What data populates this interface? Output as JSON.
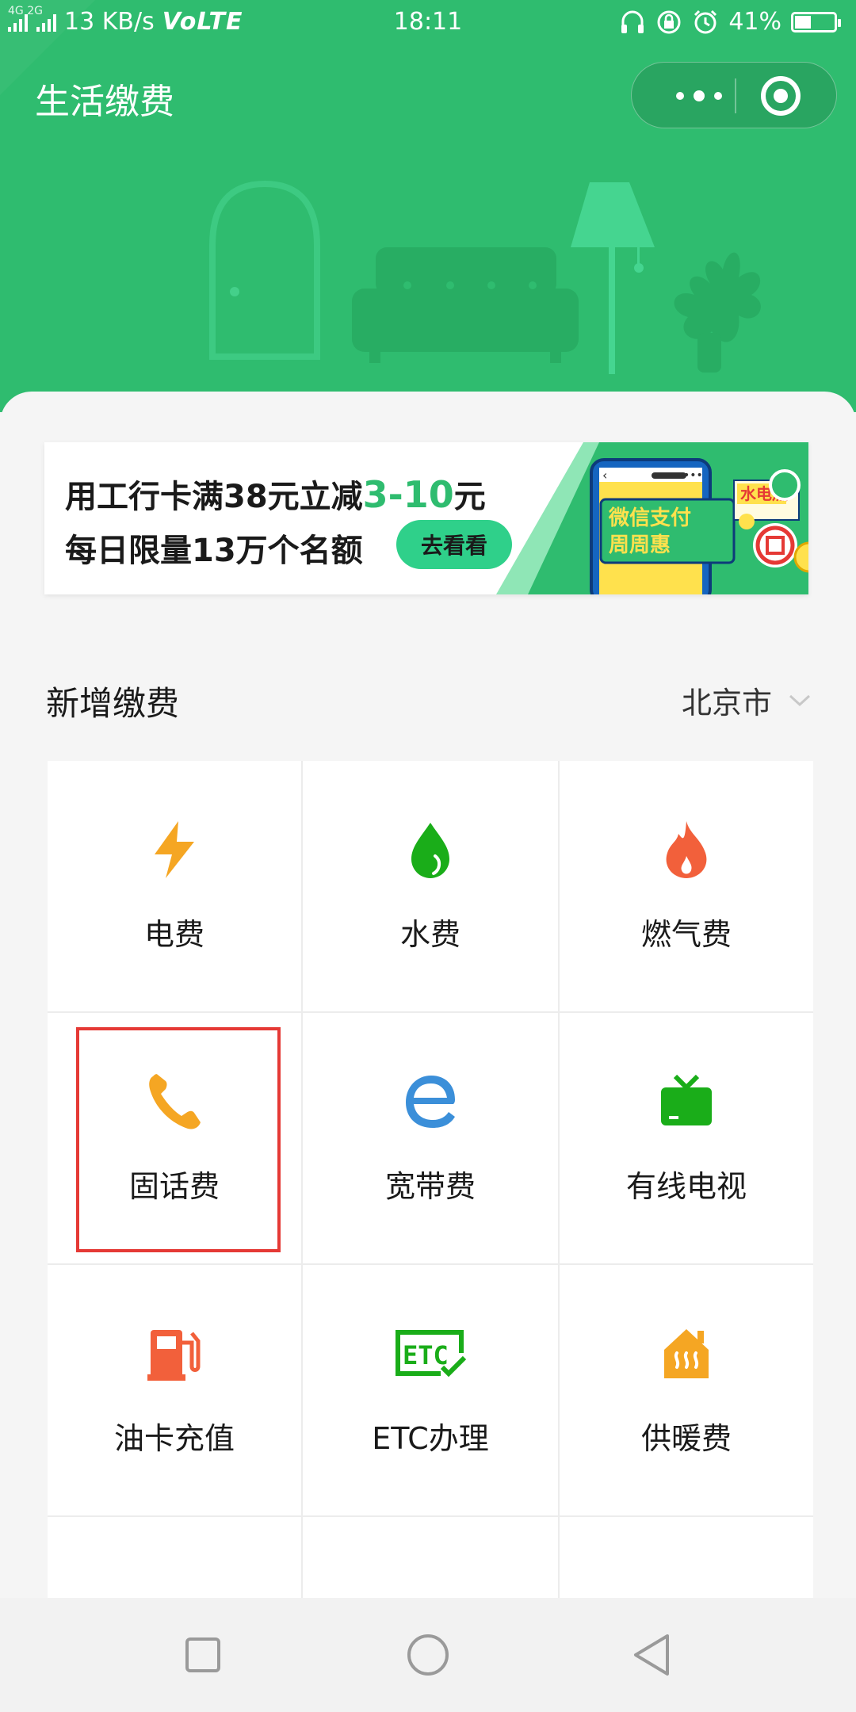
{
  "status_bar": {
    "network": "4G 2G",
    "speed": "13 KB/s",
    "volte": "VoLTE",
    "time": "18:11",
    "battery": "41%",
    "battery_level": 0.41
  },
  "nav": {
    "title": "生活缴费"
  },
  "banner": {
    "line1_prefix": "用工行卡满38元立减",
    "line1_accent": "3-10",
    "line1_suffix": "元",
    "line2": "每日限量13万个名额",
    "button": "去看看",
    "art_tag": "水电燃",
    "art_line1": "微信支付",
    "art_line2": "周周惠"
  },
  "section": {
    "title": "新增缴费",
    "city": "北京市"
  },
  "services": [
    {
      "label": "电费",
      "icon": "lightning-icon",
      "color": "#f5a623"
    },
    {
      "label": "水费",
      "icon": "water-drop-icon",
      "color": "#1aad19"
    },
    {
      "label": "燃气费",
      "icon": "flame-icon",
      "color": "#f2603b"
    },
    {
      "label": "固话费",
      "icon": "phone-icon",
      "color": "#f5a623"
    },
    {
      "label": "宽带费",
      "icon": "broadband-e-icon",
      "color": "#3b8fd9"
    },
    {
      "label": "有线电视",
      "icon": "tv-icon",
      "color": "#1aad19"
    },
    {
      "label": "油卡充值",
      "icon": "fuel-pump-icon",
      "color": "#f2603b"
    },
    {
      "label": "ETC办理",
      "icon": "etc-icon",
      "color": "#1aad19"
    },
    {
      "label": "供暖费",
      "icon": "heating-house-icon",
      "color": "#f5a623"
    }
  ],
  "colors": {
    "brand": "#2fbc6f",
    "highlight": "#e53935"
  }
}
